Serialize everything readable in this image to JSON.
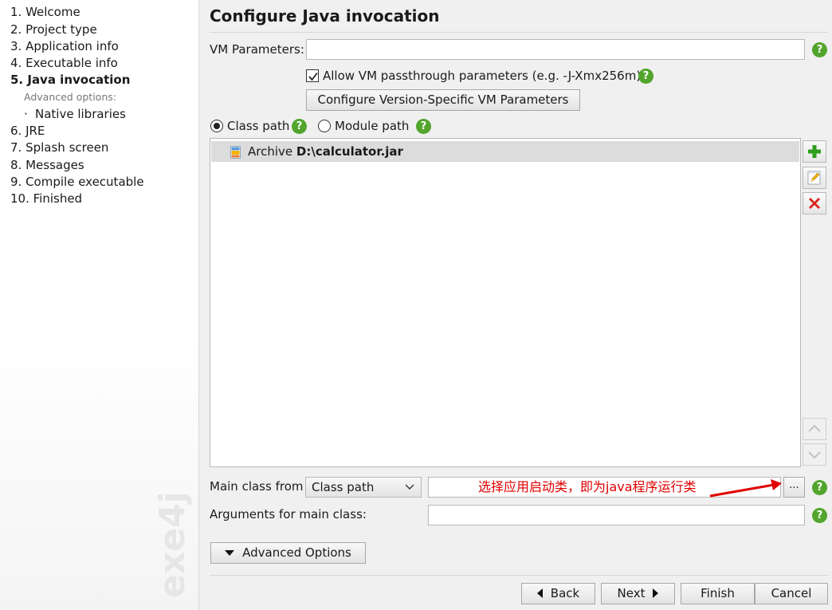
{
  "sidebar": {
    "steps": [
      {
        "label": "1. Welcome"
      },
      {
        "label": "2. Project type"
      },
      {
        "label": "3. Application info"
      },
      {
        "label": "4. Executable info"
      },
      {
        "label": "5. Java invocation",
        "active": true
      },
      {
        "label": "Advanced options:"
      },
      {
        "label": "Native libraries"
      },
      {
        "label": "6. JRE"
      },
      {
        "label": "7. Splash screen"
      },
      {
        "label": "8. Messages"
      },
      {
        "label": "9. Compile executable"
      },
      {
        "label": "10. Finished"
      }
    ],
    "brand": "exe4j"
  },
  "main": {
    "title": "Configure Java invocation",
    "vm_parameters_label": "VM Parameters:",
    "vm_parameters_value": "",
    "allow_passthrough_label": "Allow VM passthrough parameters (e.g. -J-Xmx256m)",
    "allow_passthrough_checked": true,
    "configure_vm_button": "Configure Version-Specific VM Parameters",
    "class_path_radio": "Class path",
    "module_path_radio": "Module path",
    "selected_path_mode": "Class path",
    "classpath_entries": [
      {
        "type": "Archive",
        "path": "D:\\calculator.jar"
      }
    ],
    "main_class_from_label": "Main class from",
    "main_class_from_value": "Class path",
    "main_class_annotation": "选择应用启动类，即为java程序运行类",
    "browse_button": "...",
    "arguments_label": "Arguments for main class:",
    "arguments_value": "",
    "advanced_options_button": "Advanced Options"
  },
  "footer": {
    "back": "Back",
    "next": "Next",
    "finish": "Finish",
    "cancel": "Cancel"
  },
  "colors": {
    "help_green": "#52a52c",
    "annotation_red": "#e00000",
    "delete_red": "#d9251d",
    "add_green": "#2f9e1f"
  },
  "icons": {
    "help": "question-circle-icon",
    "add": "plus-icon",
    "edit": "pencil-icon",
    "delete": "x-icon",
    "move_up": "chevron-up-icon",
    "move_down": "chevron-down-icon",
    "jar": "jar-archive-icon"
  }
}
